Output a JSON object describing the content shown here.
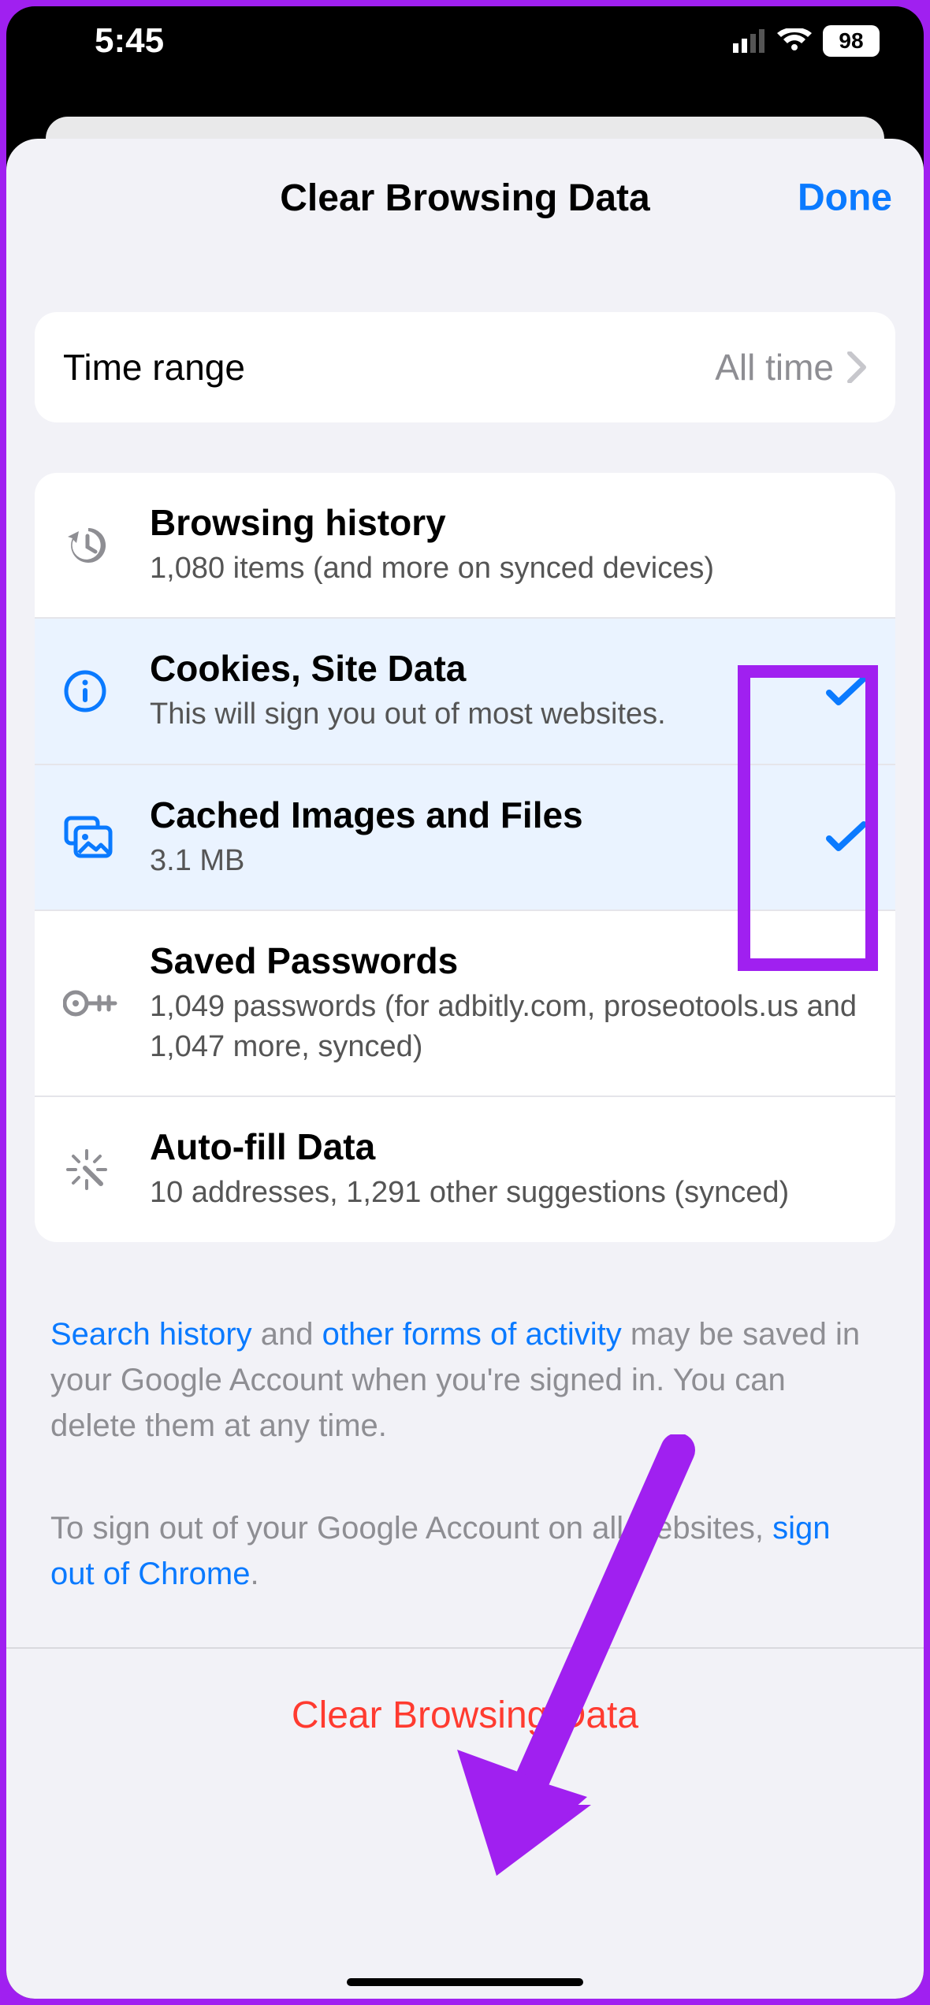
{
  "status": {
    "time": "5:45",
    "battery": "98"
  },
  "nav": {
    "title": "Clear Browsing Data",
    "done": "Done"
  },
  "time_range": {
    "label": "Time range",
    "value": "All time"
  },
  "items": {
    "history": {
      "title": "Browsing history",
      "sub": "1,080 items (and more on synced devices)"
    },
    "cookies": {
      "title": "Cookies, Site Data",
      "sub": "This will sign you out of most websites."
    },
    "cache": {
      "title": "Cached Images and Files",
      "sub": "3.1 MB"
    },
    "passwords": {
      "title": "Saved Passwords",
      "sub": "1,049 passwords (for adbitly.com, proseotools.us and 1,047 more, synced)"
    },
    "autofill": {
      "title": "Auto-fill Data",
      "sub": "10 addresses, 1,291 other suggestions (synced)"
    }
  },
  "footer1": {
    "link1": "Search history",
    "mid1": " and ",
    "link2": "other forms of activity",
    "rest": " may be saved in your Google Account when you're signed in. You can delete them at any time."
  },
  "footer2": {
    "pre": "To sign out of your Google Account on all websites, ",
    "link": "sign out of Chrome",
    "post": "."
  },
  "action": {
    "label": "Clear Browsing Data"
  }
}
